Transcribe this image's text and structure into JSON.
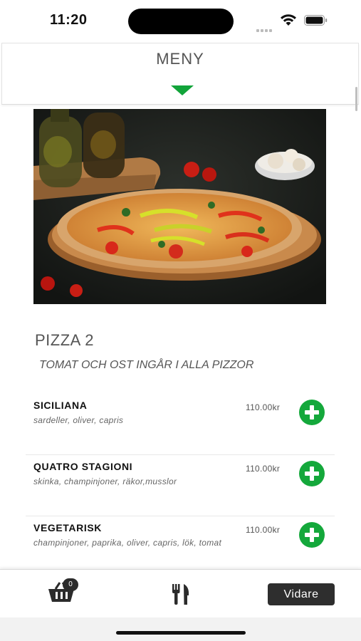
{
  "status_bar": {
    "time": "11:20"
  },
  "header": {
    "title": "MENY"
  },
  "section": {
    "title": "PIZZA 2",
    "subtitle": "TOMAT OCH OST INGÅR I ALLA PIZZOR"
  },
  "items": [
    {
      "name": "SICILIANA",
      "description": "sardeller, oliver, capris",
      "price": "110.00kr"
    },
    {
      "name": "QUATRO STAGIONI",
      "description": "skinka, champinjoner, räkor,musslor",
      "price": "110.00kr"
    },
    {
      "name": "VEGETARISK",
      "description": "champinjoner, paprika, oliver, capris, lök, tomat",
      "price": "110.00kr"
    }
  ],
  "bottom_bar": {
    "cart_count": "0",
    "next_label": "Vidare"
  },
  "colors": {
    "accent_green": "#14a83b",
    "dark_button": "#2e2e2e"
  },
  "icons": [
    "wifi-icon",
    "battery-icon",
    "chevron-down-icon",
    "plus-icon",
    "cart-icon",
    "cutlery-icon"
  ]
}
